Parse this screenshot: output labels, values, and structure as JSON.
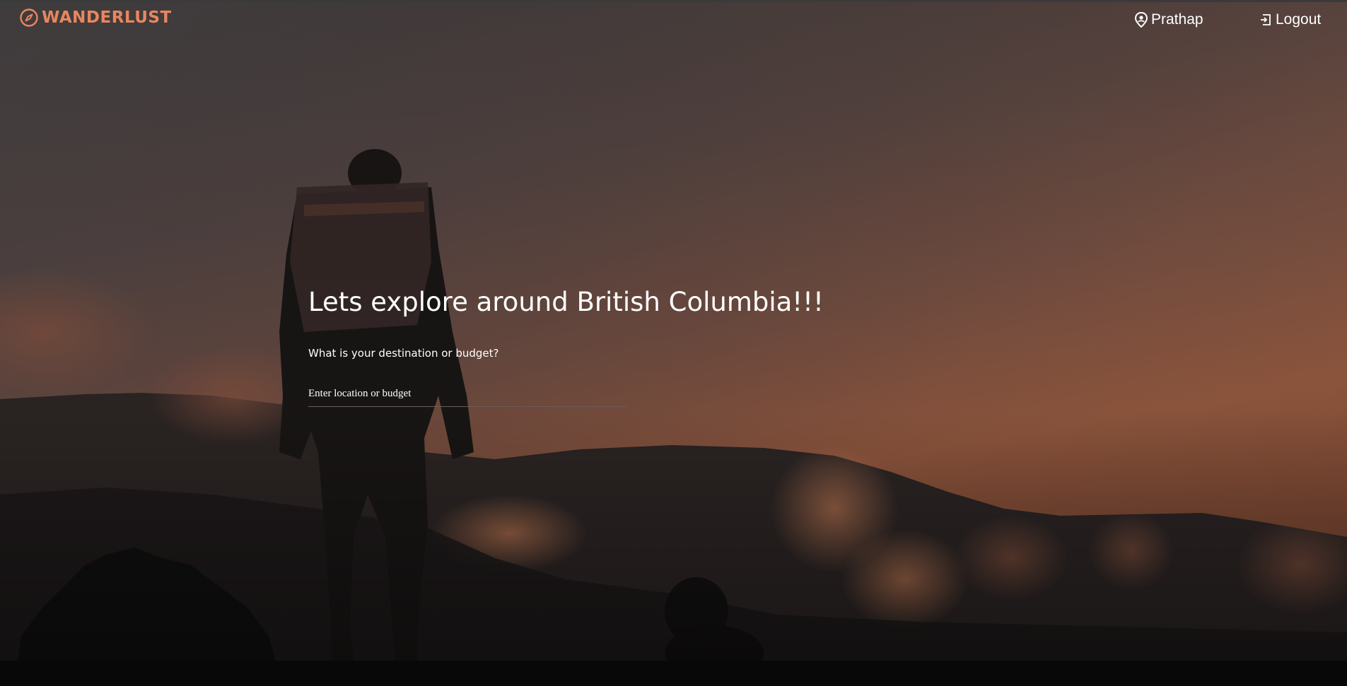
{
  "header": {
    "brand": "WANDERLUST",
    "brand_icon": "compass-icon",
    "brand_color": "#e8865f",
    "user_name": "Prathap",
    "user_icon": "user-pin-icon",
    "logout_label": "Logout",
    "logout_icon": "logout-icon"
  },
  "hero": {
    "title": "Lets explore around British Columbia!!!",
    "question": "What is your destination or budget?",
    "search_placeholder": "Enter location or budget",
    "search_value": ""
  },
  "colors": {
    "sky_top": "#4f4a4b",
    "sky_bottom": "#a05a3e",
    "ground": "#0e0d0f",
    "text": "#ffffff"
  }
}
